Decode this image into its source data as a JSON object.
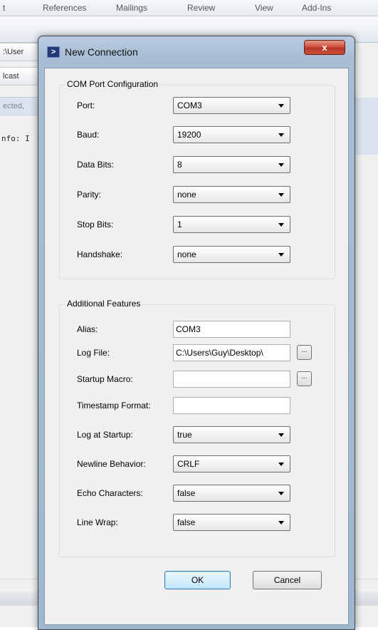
{
  "background_app": {
    "ribbon_tabs": [
      "t",
      "References",
      "Mailings",
      "Review",
      "View",
      "Add-Ins"
    ],
    "side_labels": [
      ":\\User",
      "lcast",
      "ected,"
    ],
    "console_text": "nfo: I"
  },
  "dialog": {
    "title": "New Connection",
    "icon_glyph": ">",
    "close_glyph": "x",
    "com_group": {
      "title": "COM Port Configuration",
      "fields": [
        {
          "label": "Port:",
          "value": "COM3"
        },
        {
          "label": "Baud:",
          "value": "19200"
        },
        {
          "label": "Data Bits:",
          "value": "8"
        },
        {
          "label": "Parity:",
          "value": "none"
        },
        {
          "label": "Stop Bits:",
          "value": "1"
        },
        {
          "label": "Handshake:",
          "value": "none"
        }
      ]
    },
    "features_group": {
      "title": "Additional Features",
      "alias": {
        "label": "Alias:",
        "value": "COM3"
      },
      "log_file": {
        "label": "Log File:",
        "value": "C:\\Users\\Guy\\Desktop\\"
      },
      "startup_macro": {
        "label": "Startup Macro:",
        "value": ""
      },
      "timestamp_format": {
        "label": "Timestamp Format:",
        "value": ""
      },
      "log_at_startup": {
        "label": "Log at Startup:",
        "value": "true"
      },
      "newline_behavior": {
        "label": "Newline Behavior:",
        "value": "CRLF"
      },
      "echo_characters": {
        "label": "Echo Characters:",
        "value": "false"
      },
      "line_wrap": {
        "label": "Line Wrap:",
        "value": "false"
      },
      "browse_label": "..."
    },
    "ok_label": "OK",
    "cancel_label": "Cancel"
  }
}
